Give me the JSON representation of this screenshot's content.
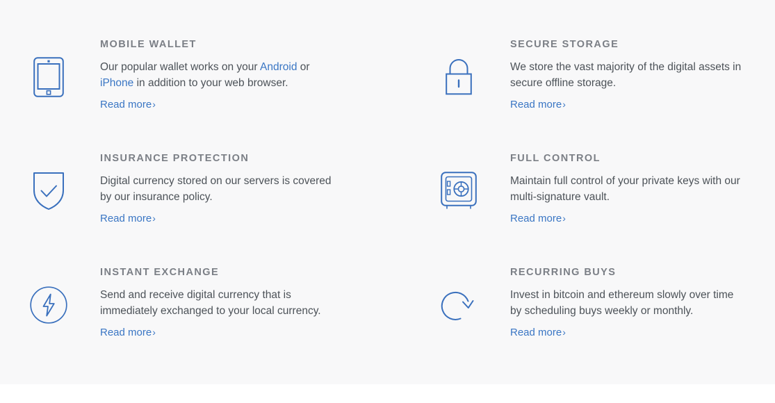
{
  "theme": {
    "section_background": "#f8f8f9",
    "page_background": "#ffffff",
    "heading_color": "#7b7f86",
    "body_text_color": "#4c5258",
    "link_color": "#3a76c4",
    "icon_stroke_color": "#3a70bd"
  },
  "features": [
    {
      "icon": "mobile-device-icon",
      "title": "MOBILE WALLET",
      "desc_part1": "Our popular wallet works on your ",
      "link1": "Android",
      "desc_part2": " or ",
      "link2": "iPhone",
      "desc_part3": " in addition to your web browser.",
      "read_more": "Read more",
      "chevron": "›"
    },
    {
      "icon": "padlock-icon",
      "title": "SECURE STORAGE",
      "desc_part1": "We store the vast majority of the digital assets in secure offline storage.",
      "link1": "",
      "desc_part2": "",
      "link2": "",
      "desc_part3": "",
      "read_more": "Read more",
      "chevron": "›"
    },
    {
      "icon": "shield-check-icon",
      "title": "INSURANCE PROTECTION",
      "desc_part1": "Digital currency stored on our servers is covered by our insurance policy.",
      "link1": "",
      "desc_part2": "",
      "link2": "",
      "desc_part3": "",
      "read_more": "Read more",
      "chevron": "›"
    },
    {
      "icon": "vault-safe-icon",
      "title": "FULL CONTROL",
      "desc_part1": "Maintain full control of your private keys with our multi-signature vault.",
      "link1": "",
      "desc_part2": "",
      "link2": "",
      "desc_part3": "",
      "read_more": "Read more",
      "chevron": "›"
    },
    {
      "icon": "lightning-bolt-circle-icon",
      "title": "INSTANT EXCHANGE",
      "desc_part1": "Send and receive digital currency that is immediately exchanged to your local currency.",
      "link1": "",
      "desc_part2": "",
      "link2": "",
      "desc_part3": "",
      "read_more": "Read more",
      "chevron": "›"
    },
    {
      "icon": "circular-arrow-icon",
      "title": "RECURRING BUYS",
      "desc_part1": "Invest in bitcoin and ethereum slowly over time by scheduling buys weekly or monthly.",
      "link1": "",
      "desc_part2": "",
      "link2": "",
      "desc_part3": "",
      "read_more": "Read more",
      "chevron": "›"
    }
  ]
}
